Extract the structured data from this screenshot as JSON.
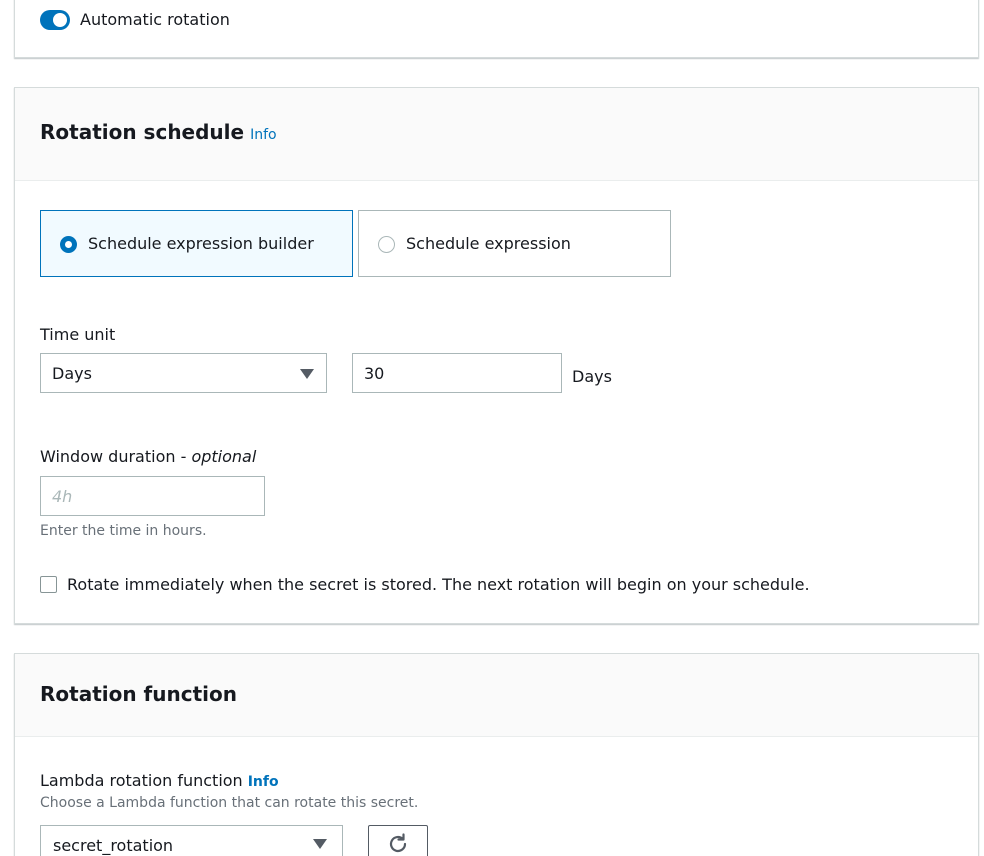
{
  "automatic_rotation": {
    "label": "Automatic rotation",
    "enabled": true
  },
  "rotation_schedule": {
    "title": "Rotation schedule",
    "info_label": "Info",
    "options": [
      {
        "label": "Schedule expression builder",
        "selected": true
      },
      {
        "label": "Schedule expression",
        "selected": false
      }
    ],
    "time_unit": {
      "label": "Time unit",
      "selected_value": "Days",
      "amount_value": "30",
      "amount_suffix": "Days"
    },
    "window_duration": {
      "label": "Window duration - ",
      "label_optional": "optional",
      "placeholder": "4h",
      "hint": "Enter the time in hours."
    },
    "rotate_immediately": {
      "label": "Rotate immediately when the secret is stored. The next rotation will begin on your schedule.",
      "checked": false
    }
  },
  "rotation_function": {
    "title": "Rotation function",
    "lambda_label": "Lambda rotation function",
    "info_label": "Info",
    "description": "Choose a Lambda function that can rotate this secret.",
    "selected_function": "secret_rotation",
    "refresh_icon": "refresh-icon"
  },
  "colors": {
    "accent": "#0073bb",
    "panel_header_bg": "#fafafa",
    "border": "#aab7b8"
  }
}
